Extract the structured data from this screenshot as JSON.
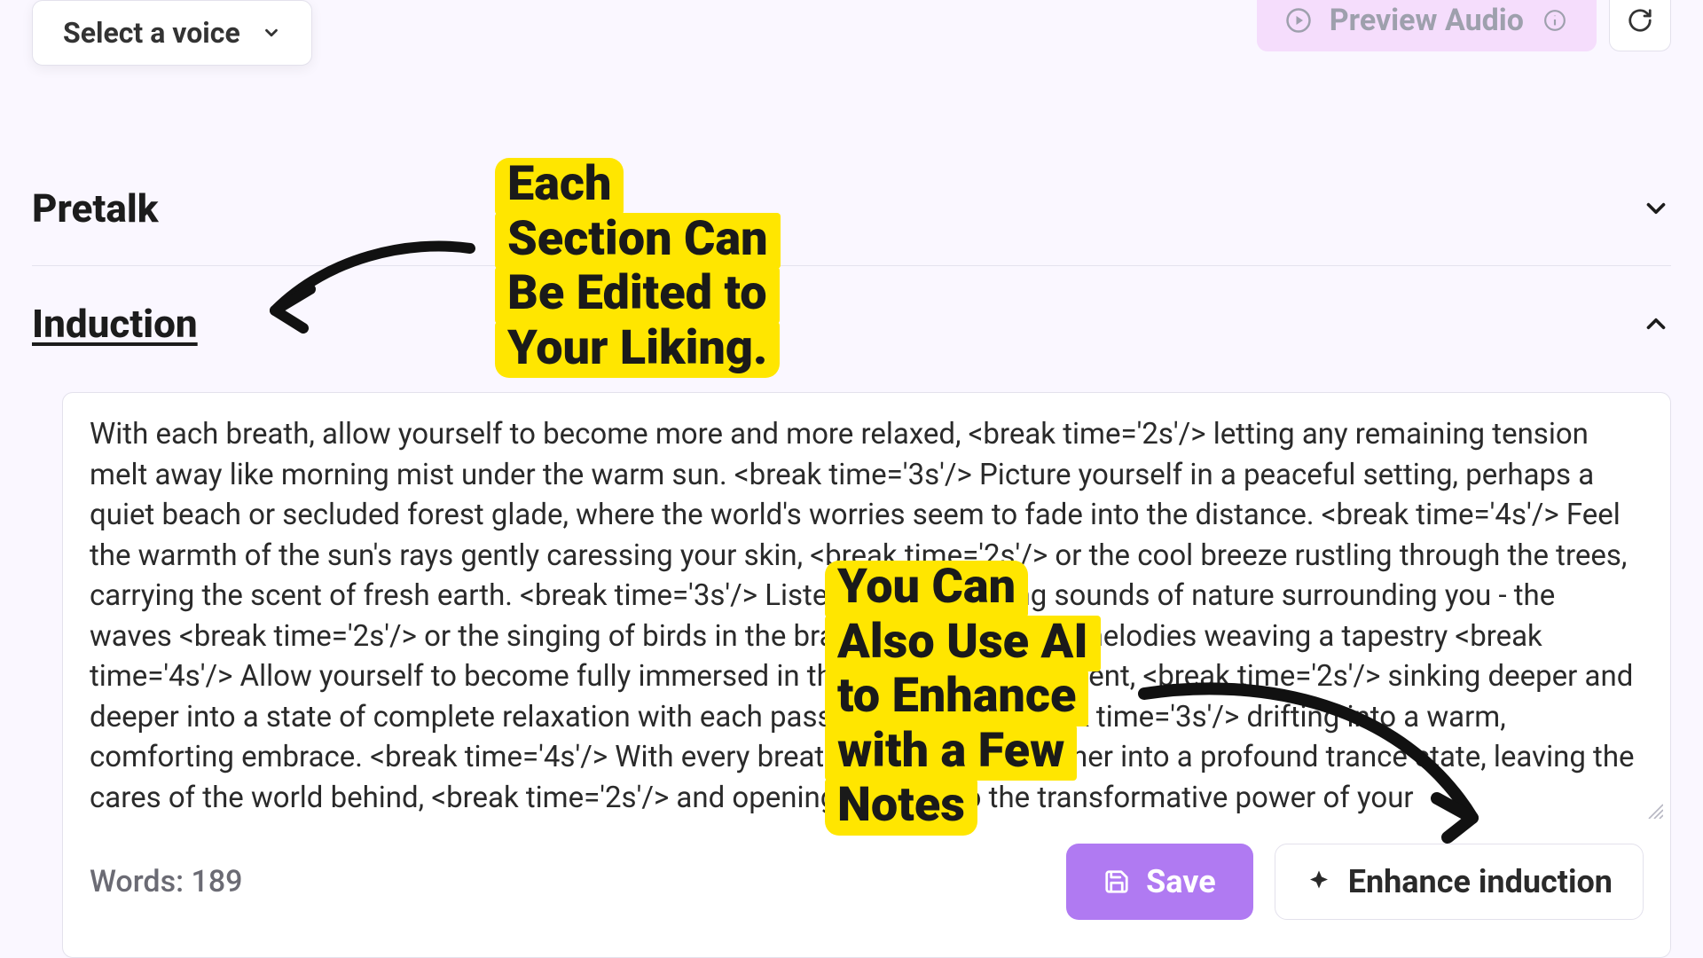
{
  "toolbar": {
    "voice_label": "Select a voice",
    "preview_label": "Preview Audio"
  },
  "sections": [
    {
      "title": "Pretalk",
      "expanded": false
    },
    {
      "title": "Induction",
      "expanded": true
    }
  ],
  "editor": {
    "text": "With each breath, allow yourself to become more and more relaxed, <break time='2s'/> letting any remaining tension melt away like morning mist under the warm sun. <break time='3s'/> Picture yourself in a peaceful setting, perhaps a quiet beach or secluded forest glade, where the world's worries seem to fade into the distance. <break time='4s'/> Feel the warmth of the sun's rays gently caressing your skin, <break time='2s'/> or the cool breeze rustling through the trees, carrying the scent of fresh earth. <break time='3s'/> Listen to the soothing sounds of nature surrounding you - the waves <break time='2s'/> or the singing of birds in the branches above, their melodies weaving a tapestry <break time='4s'/> Allow yourself to become fully immersed in this tranquil environment, <break time='2s'/> sinking deeper and deeper into a state of complete relaxation with each passing moment, <break time='3s'/> drifting into a warm, comforting embrace. <break time='4s'/> With every breath, you descend further into a profound trance state, leaving the cares of the world behind, <break time='2s'/> and opening yourself to the transformative power of your",
    "word_label": "Words:",
    "word_count": "189",
    "save_label": "Save",
    "enhance_label": "Enhance induction"
  },
  "callouts": {
    "c1": [
      "Each",
      "Section Can",
      "Be Edited to",
      "Your Liking."
    ],
    "c2": [
      "You Can",
      "Also Use AI",
      "to Enhance",
      "with a Few",
      "Notes"
    ]
  }
}
